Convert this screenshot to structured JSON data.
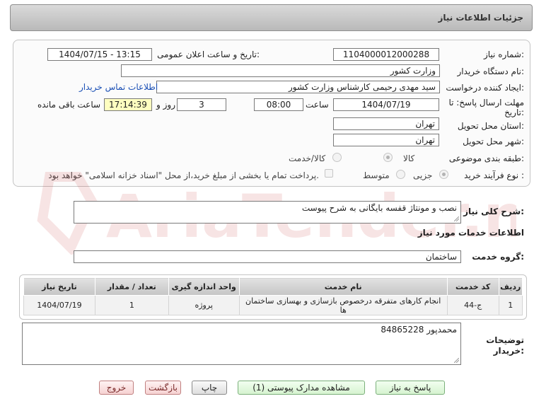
{
  "header": {
    "title": "جزئیات اطلاعات نیاز"
  },
  "form": {
    "need_number_label": "شماره نیاز:",
    "need_number": "1104000012000288",
    "announce_label": "تاریخ و ساعت اعلان عمومی:",
    "announce_value": "1404/07/15 - 13:15",
    "buyer_org_label": "نام دستگاه خریدار:",
    "buyer_org": "وزارت کشور",
    "creator_label": "ایجاد کننده درخواست:",
    "creator": "سید مهدی رحیمی کارشناس وزارت کشور",
    "contact_link": "اطلاعات تماس خریدار",
    "deadline_label_line1": "مهلت ارسال پاسخ: تا",
    "deadline_label_line2": "تاریخ:",
    "deadline_date": "1404/07/19",
    "time_label": "ساعت",
    "deadline_time": "08:00",
    "days_value": "3",
    "days_label": "روز و",
    "remaining_time": "17:14:39",
    "remaining_label": "ساعت باقی مانده",
    "province_label": "استان محل تحویل:",
    "province": "تهران",
    "city_label": "شهر محل تحویل:",
    "city": "تهران",
    "category_label": "طبقه بندی موضوعی:",
    "category_options": [
      "کالا",
      "کالا/خدمت"
    ],
    "process_label": "نوع فرآیند خرید :",
    "process_options": [
      "جزیی",
      "متوسط"
    ],
    "payment_note": "پرداخت تمام یا بخشی از مبلغ خرید،از محل \"اسناد خزانه اسلامی\" خواهد بود."
  },
  "description": {
    "label": "شرح کلی نیاز:",
    "value": "نصب و مونتاژ قفسه بایگانی به شرح پیوست"
  },
  "services": {
    "section_title": "اطلاعات خدمات مورد نیاز",
    "group_label": "گروه خدمت:",
    "group_value": "ساختمان",
    "columns": [
      "ردیف",
      "کد خدمت",
      "نام خدمت",
      "واحد اندازه گیری",
      "تعداد / مقدار",
      "تاریخ نیاز"
    ],
    "rows": [
      {
        "row": "1",
        "code": "ج-44",
        "name": "انجام کارهای متفرقه درخصوص بازسازی و بهسازی ساختمان ها",
        "unit": "پروژه",
        "qty": "1",
        "date": "1404/07/19"
      }
    ]
  },
  "buyer_notes": {
    "label_line1": "توضیحات",
    "label_line2": "خریدار:",
    "value": "84865228 محمدپور"
  },
  "buttons": {
    "reply": "پاسخ به نیاز",
    "attachments": "مشاهده مدارک پیوستی (1)",
    "print": "چاپ",
    "back": "بازگشت",
    "exit": "خروج"
  },
  "watermark": {
    "text": "AriaTender.net",
    "color": "#c62828"
  }
}
